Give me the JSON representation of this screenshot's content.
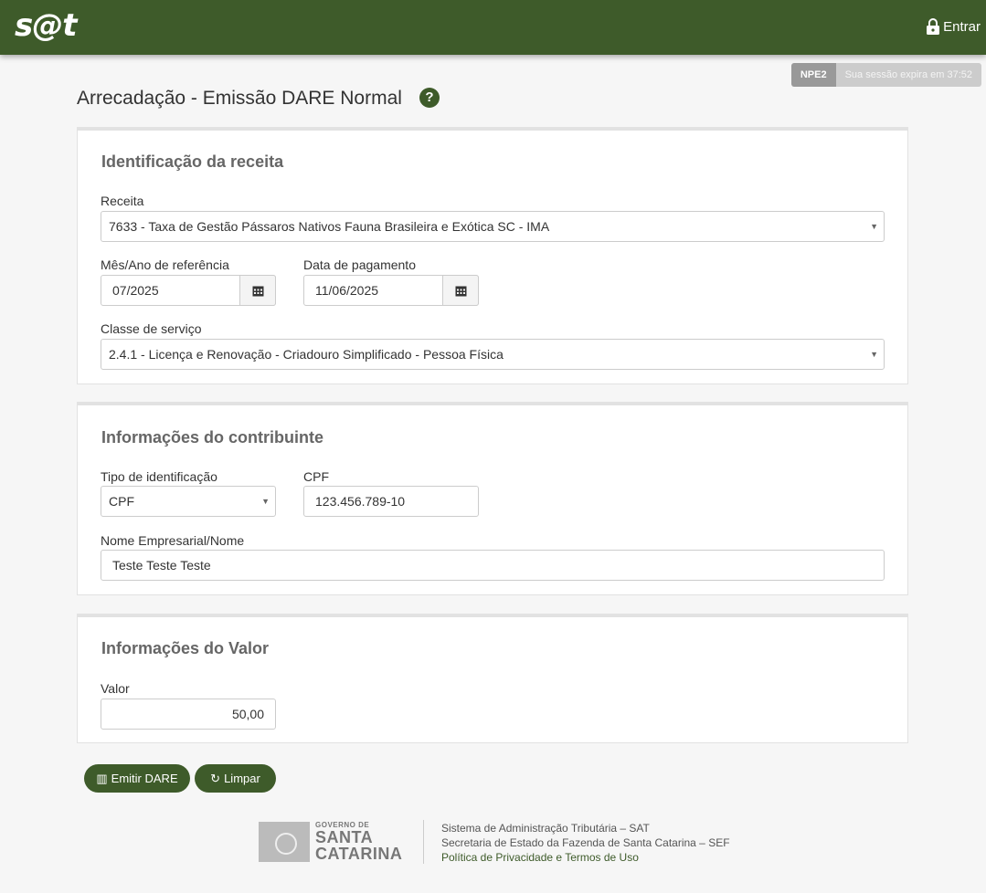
{
  "header": {
    "logo": "s@t",
    "login_label": "Entrar"
  },
  "session": {
    "environment": "NPE2",
    "expiry_text": "Sua sessão expira em 37:52"
  },
  "page": {
    "title": "Arrecadação - Emissão DARE Normal",
    "help_icon": "?"
  },
  "revenue_section": {
    "title": "Identificação da receita",
    "receita_label": "Receita",
    "receita_value": "7633 - Taxa de Gestão Pássaros Nativos Fauna Brasileira e Exótica SC - IMA",
    "month_label": "Mês/Ano de referência",
    "month_value": "07/2025",
    "payment_date_label": "Data de pagamento",
    "payment_date_value": "11/06/2025",
    "service_class_label": "Classe de serviço",
    "service_class_value": "2.4.1 - Licença e Renovação - Criadouro Simplificado - Pessoa Física"
  },
  "taxpayer_section": {
    "title": "Informações do contribuinte",
    "id_type_label": "Tipo de identificação",
    "id_type_value": "CPF",
    "cpf_label": "CPF",
    "cpf_value": "123.456.789-10",
    "name_label": "Nome Empresarial/Nome",
    "name_value": "Teste Teste Teste"
  },
  "value_section": {
    "title": "Informações do Valor",
    "value_label": "Valor",
    "value_value": "50,00"
  },
  "actions": {
    "emit_label": "Emitir DARE",
    "clear_label": "Limpar"
  },
  "footer": {
    "gov_small": "GOVERNO DE",
    "gov_line1": "SANTA",
    "gov_line2": "CATARINA",
    "line1": "Sistema de Administração Tributária – SAT",
    "line2": "Secretaria de Estado da Fazenda de Santa Catarina – SEF",
    "privacy_link": "Política de Privacidade e Termos de Uso"
  },
  "colors": {
    "brand": "#3e5b2a",
    "background": "#f6f6f6"
  }
}
